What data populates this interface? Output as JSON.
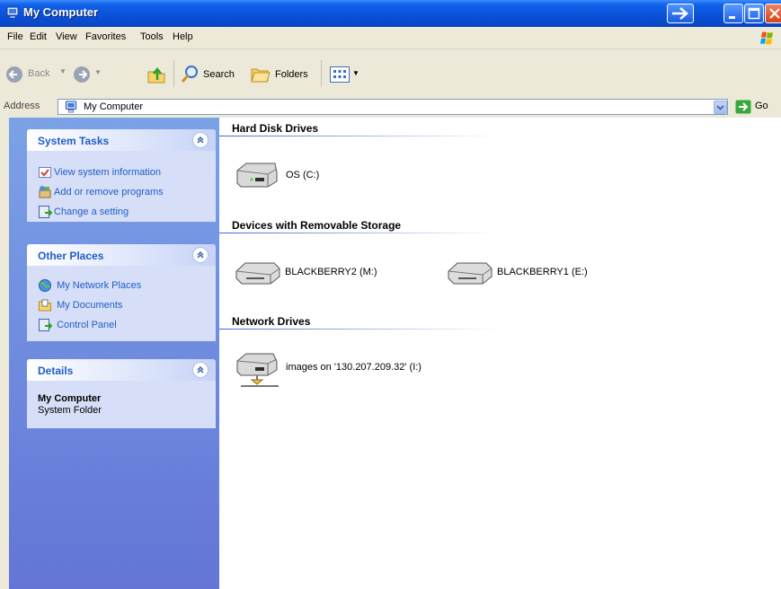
{
  "window": {
    "title": "My Computer",
    "title_icon": "my-computer-icon"
  },
  "menu": {
    "items": [
      {
        "label": "File"
      },
      {
        "label": "Edit"
      },
      {
        "label": "View"
      },
      {
        "label": "Favorites"
      },
      {
        "label": "Tools"
      },
      {
        "label": "Help"
      }
    ]
  },
  "toolbar": {
    "back_label": "Back",
    "search_label": "Search",
    "folders_label": "Folders"
  },
  "address": {
    "label": "Address",
    "value": "My Computer",
    "go_label": "Go"
  },
  "system_tasks": {
    "title": "System Tasks",
    "links": [
      {
        "label": "View system information",
        "icon": "system-info-icon"
      },
      {
        "label": "Add or remove programs",
        "icon": "add-remove-programs-icon"
      },
      {
        "label": "Change a setting",
        "icon": "control-panel-icon"
      }
    ]
  },
  "other_places": {
    "title": "Other Places",
    "links": [
      {
        "label": "My Network Places",
        "icon": "network-places-icon"
      },
      {
        "label": "My Documents",
        "icon": "my-documents-icon"
      },
      {
        "label": "Control Panel",
        "icon": "control-panel-icon"
      }
    ]
  },
  "details": {
    "title": "Details",
    "name": "My Computer",
    "type": "System Folder"
  },
  "groups": {
    "hard_disk": {
      "title": "Hard Disk Drives",
      "drives": [
        {
          "label": "OS (C:)"
        }
      ]
    },
    "removable": {
      "title": "Devices with Removable Storage",
      "drives": [
        {
          "label": "BLACKBERRY2 (M:)"
        },
        {
          "label": "BLACKBERRY1 (E:)"
        }
      ]
    },
    "network": {
      "title": "Network Drives",
      "drives": [
        {
          "label": "images on '130.207.209.32' (I:)"
        }
      ]
    }
  },
  "colors": {
    "title_bar": "#0a4fd8",
    "task_pane": "#6375d6",
    "link": "#215dc6"
  }
}
